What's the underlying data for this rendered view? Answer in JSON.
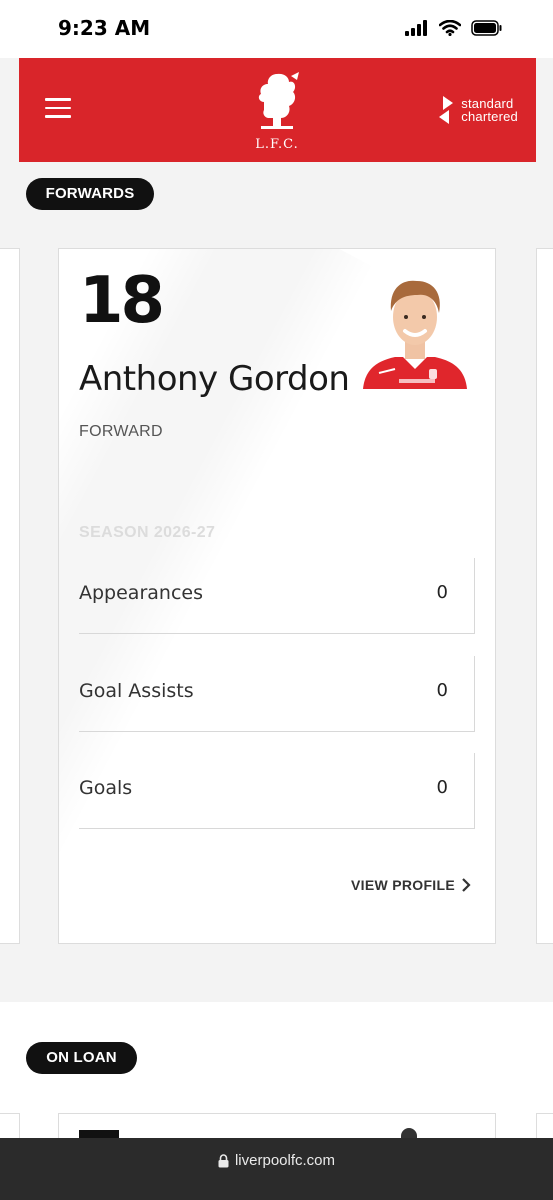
{
  "status_bar": {
    "time": "9:23 AM"
  },
  "header": {
    "menu_icon": "hamburger-menu-icon",
    "club_logo_text": "L.F.C.",
    "sponsor_line1": "standard",
    "sponsor_line2": "chartered",
    "brand_color": "#d9252a"
  },
  "sections": {
    "forwards_label": "FORWARDS",
    "loan_label": "ON LOAN"
  },
  "player_card": {
    "number": "18",
    "name": "Anthony Gordon",
    "position": "FORWARD",
    "season": "SEASON 2026-27",
    "stats": [
      {
        "label": "Appearances",
        "value": "0"
      },
      {
        "label": "Goal Assists",
        "value": "0"
      },
      {
        "label": "Goals",
        "value": "0"
      }
    ],
    "view_profile": "VIEW PROFILE"
  },
  "url_bar": {
    "domain": "liverpoolfc.com"
  }
}
